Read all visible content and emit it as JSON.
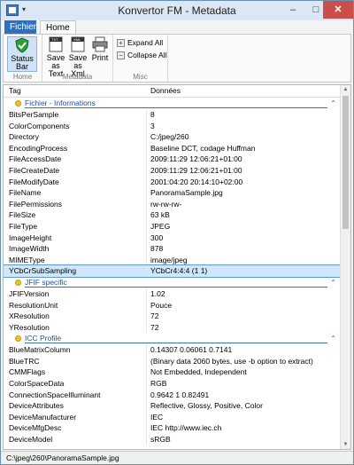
{
  "window": {
    "title": "Konvertor FM - Metadata"
  },
  "title_buttons": {
    "minimize": "–",
    "maximize": "□",
    "close": "✕"
  },
  "tabs": {
    "file": "Fichier",
    "home": "Home"
  },
  "ribbon": {
    "home_group": {
      "label": "Home",
      "status_bar": "Status Bar"
    },
    "metadata_group": {
      "label": "Metadata",
      "save_text": "Save as Text",
      "save_xml": "Save as Xml",
      "print": "Print"
    },
    "misc_group": {
      "label": "Misc",
      "expand_all": "Expand All",
      "collapse_all": "Collapse All"
    }
  },
  "grid": {
    "col_tag": "Tag",
    "col_value": "Données",
    "groups": [
      {
        "title": "Fichier - Informations",
        "rows": [
          {
            "tag": "BitsPerSample",
            "value": "8"
          },
          {
            "tag": "ColorComponents",
            "value": "3"
          },
          {
            "tag": "Directory",
            "value": "C:/jpeg/260"
          },
          {
            "tag": "EncodingProcess",
            "value": "Baseline DCT, codage Huffman"
          },
          {
            "tag": "FileAccessDate",
            "value": "2009:11:29 12:06:21+01:00"
          },
          {
            "tag": "FileCreateDate",
            "value": "2009:11:29 12:06:21+01:00"
          },
          {
            "tag": "FileModifyDate",
            "value": "2001:04:20 20:14:10+02:00"
          },
          {
            "tag": "FileName",
            "value": "PanoramaSample.jpg"
          },
          {
            "tag": "FilePermissions",
            "value": "rw-rw-rw-"
          },
          {
            "tag": "FileSize",
            "value": "63 kB"
          },
          {
            "tag": "FileType",
            "value": "JPEG"
          },
          {
            "tag": "ImageHeight",
            "value": "300"
          },
          {
            "tag": "ImageWidth",
            "value": "878"
          },
          {
            "tag": "MIMEType",
            "value": "image/jpeg"
          },
          {
            "tag": "YCbCrSubSampling",
            "value": "YCbCr4:4:4 (1 1)",
            "selected": true
          }
        ]
      },
      {
        "title": "JFIF specific",
        "rows": [
          {
            "tag": "JFIFVersion",
            "value": "1.02"
          },
          {
            "tag": "ResolutionUnit",
            "value": "Pouce"
          },
          {
            "tag": "XResolution",
            "value": "72"
          },
          {
            "tag": "YResolution",
            "value": "72"
          }
        ]
      },
      {
        "title": "ICC Profile",
        "rows": [
          {
            "tag": "BlueMatrixColumn",
            "value": "0.14307 0.06061 0.7141"
          },
          {
            "tag": "BlueTRC",
            "value": "(Binary data 2060 bytes, use -b option to extract)"
          },
          {
            "tag": "CMMFlags",
            "value": "Not Embedded, Independent"
          },
          {
            "tag": "ColorSpaceData",
            "value": "RGB"
          },
          {
            "tag": "ConnectionSpaceIlluminant",
            "value": "0.9642 1 0.82491"
          },
          {
            "tag": "DeviceAttributes",
            "value": "Reflective, Glossy, Positive, Color"
          },
          {
            "tag": "DeviceManufacturer",
            "value": "IEC"
          },
          {
            "tag": "DeviceMfgDesc",
            "value": "IEC http://www.iec.ch"
          },
          {
            "tag": "DeviceModel",
            "value": "sRGB"
          }
        ]
      }
    ]
  },
  "statusbar": {
    "path": "C:\\jpeg\\260\\PanoramaSample.jpg"
  },
  "colors": {
    "accent": "#2b6fc6",
    "group_title": "#1e4e9b",
    "selection": "#cfe6fb",
    "close": "#c7504a"
  }
}
